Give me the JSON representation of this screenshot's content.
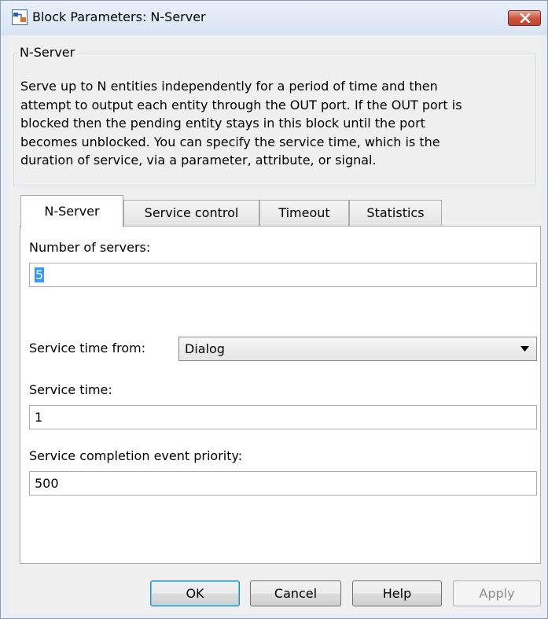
{
  "window": {
    "title": "Block Parameters: N-Server"
  },
  "header": {
    "group_title": "N-Server",
    "description": "Serve up to N entities independently for a period of time and then\nattempt to output each entity through the OUT port. If the OUT port is\nblocked then the pending entity stays in this block until the port\nbecomes unblocked. You can specify the service time, which is the\nduration of service, via a parameter, attribute, or signal."
  },
  "tabs": [
    {
      "label": "N-Server",
      "active": true
    },
    {
      "label": "Service control",
      "active": false
    },
    {
      "label": "Timeout",
      "active": false
    },
    {
      "label": "Statistics",
      "active": false
    }
  ],
  "params": {
    "num_servers_label": "Number of servers:",
    "num_servers_value": "5",
    "service_time_from_label": "Service time from:",
    "service_time_from_value": "Dialog",
    "service_time_label": "Service time:",
    "service_time_value": "1",
    "completion_priority_label": "Service completion event priority:",
    "completion_priority_value": "500"
  },
  "buttons": {
    "ok": "OK",
    "cancel": "Cancel",
    "help": "Help",
    "apply": "Apply"
  },
  "icons": {
    "app": "simulink-block-icon",
    "close": "close-icon",
    "dropdown": "chevron-down-icon"
  },
  "colors": {
    "close_button": "#c5432c",
    "selection": "#3399ff",
    "window_frame": "#e9eef6"
  }
}
